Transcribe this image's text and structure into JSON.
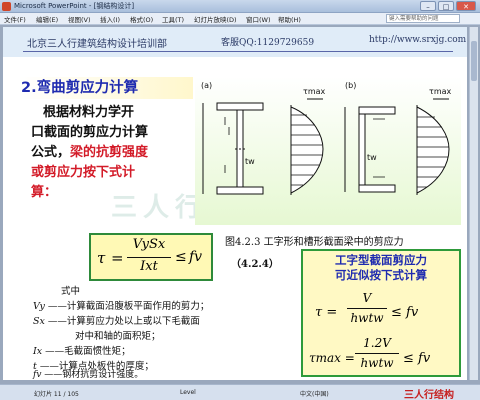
{
  "window": {
    "title": "Microsoft PowerPoint - [钢结构设计]",
    "minimize_label": "–",
    "maximize_label": "□",
    "close_label": "✕"
  },
  "menubar": {
    "items": [
      "文件(F)",
      "编辑(E)",
      "视图(V)",
      "插入(I)",
      "格式(O)",
      "工具(T)",
      "幻灯片放映(D)",
      "窗口(W)",
      "帮助(H)"
    ],
    "help_placeholder": "键入需要帮助的问题"
  },
  "slide": {
    "header_left": "北京三人行建筑结构设计培训部",
    "header_mid": "客服QQ:1129729659",
    "header_right": "http://www.srxjg.com",
    "section_title": "2.弯曲剪应力计算",
    "paragraph": {
      "line1": "根据材料力学开",
      "line2": "口截面的剪应力计算",
      "line3_black": "公式，",
      "line3_red": "梁的抗剪强度",
      "line4_red": "或剪应力按下式计",
      "line5_red": "算："
    },
    "figure": {
      "label_a": "(a)",
      "label_b": "(b)",
      "tau_max_a": "τmax",
      "tau_max_b": "τmax",
      "tw_a": "tw",
      "tw_b": "tw"
    },
    "caption": "图4.2.3 工字形和槽形截面梁中的剪应力",
    "equation_number": "（4.2.4）",
    "formula": {
      "tau": "τ",
      "eq": "=",
      "num": "VySx",
      "den": "Ixt",
      "le": "≤",
      "fv": "fv"
    },
    "legend": {
      "intro": "式中",
      "vy_sym": "Vy",
      "vy_text": "——计算截面沿腹板平面作用的剪力；",
      "sx_sym": "Sx",
      "sx_text": "——计算剪应力处以上或以下毛截面",
      "sx_text2": "对中和轴的面积矩；",
      "ix_sym": "Ix",
      "ix_text": "——毛截面惯性矩；",
      "t_sym": "t",
      "t_text": "——计算点处板件的厚度；",
      "fv_sym": "fv",
      "fv_text": "——钢材抗剪设计强度。"
    },
    "right_box": {
      "title1": "工字型截面剪应力",
      "title2": "可近似按下式计算",
      "f1_lhs": "τ =",
      "f1_num": "V",
      "f1_den": "hwtw",
      "f1_rhs": "≤ fv",
      "f2_lhs": "τmax =",
      "f2_num": "1.2V",
      "f2_den": "hwtw",
      "f2_rhs": "≤ fv"
    },
    "watermark": "三人行 srxjg.com"
  },
  "statusbar": {
    "slide_indicator": "幻灯片 11 / 105",
    "design": "Level",
    "language": "中文(中国)",
    "brand": "三人行结构"
  },
  "colors": {
    "title_blue": "#1f2bb0",
    "emphasis_red": "#d31b28",
    "box_border_green": "#2e8a3a",
    "box_fill_yellow": "#fff9b5"
  }
}
